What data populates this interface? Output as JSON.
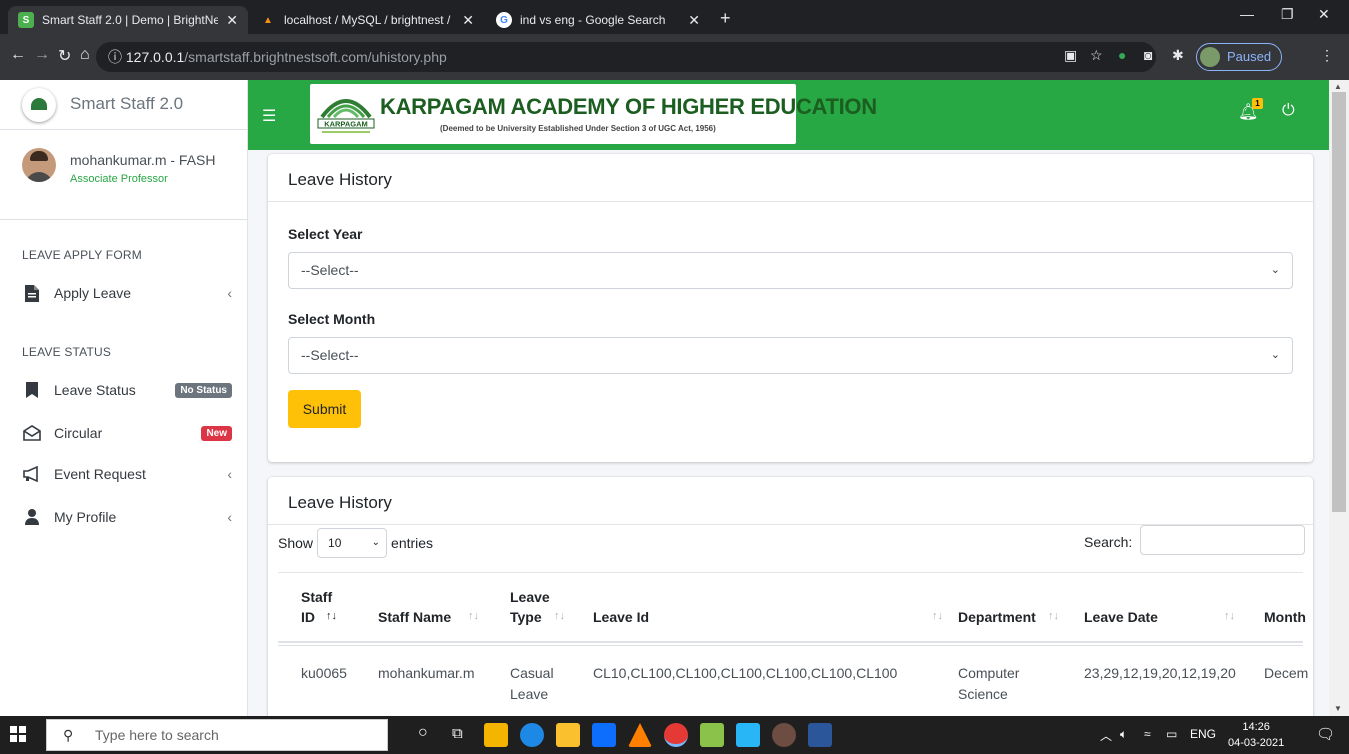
{
  "browser": {
    "tabs": [
      {
        "title": "Smart Staff 2.0 | Demo | BrightNe",
        "fav": "S",
        "fav_color": "#4caf50"
      },
      {
        "title": "localhost / MySQL / brightnest /",
        "fav": "▲",
        "fav_color": "#f29111"
      },
      {
        "title": "ind vs eng - Google Search",
        "fav": "G",
        "fav_color": "#ffffff"
      }
    ],
    "url_host": "127.0.0.1",
    "url_path": "/smartstaff.brightnestsoft.com/uhistory.php",
    "profile_status": "Paused"
  },
  "sidebar": {
    "brand": "Smart Staff 2.0",
    "user_name": "mohankumar.m - FASH",
    "user_role": "Associate Professor",
    "sections": {
      "apply": "LEAVE APPLY FORM",
      "status": "LEAVE STATUS"
    },
    "items": {
      "apply_leave": "Apply Leave",
      "leave_status": "Leave Status",
      "leave_status_badge": "No Status",
      "circular": "Circular",
      "circular_badge": "New",
      "event_request": "Event Request",
      "my_profile": "My Profile"
    }
  },
  "header": {
    "institution": "KARPAGAM ACADEMY OF HIGHER EDUCATION",
    "subtitle": "(Deemed to be University Established Under Section 3 of UGC Act, 1956)",
    "logo_text": "KARPAGAM",
    "notification_count": "1"
  },
  "filter_card": {
    "title": "Leave History",
    "year_label": "Select Year",
    "year_value": "--Select--",
    "month_label": "Select Month",
    "month_value": "--Select--",
    "submit": "Submit"
  },
  "table_card": {
    "title": "Leave History",
    "show": "Show",
    "entries_value": "10",
    "entries": "entries",
    "search_label": "Search:",
    "columns": {
      "staff_id_1": "Staff",
      "staff_id_2": "ID",
      "staff_name": "Staff Name",
      "leave_type_1": "Leave",
      "leave_type_2": "Type",
      "leave_id": "Leave Id",
      "department": "Department",
      "leave_date": "Leave Date",
      "month": "Month"
    },
    "rows": [
      {
        "staff_id": "ku0065",
        "staff_name": "mohankumar.m",
        "leave_type_1": "Casual",
        "leave_type_2": "Leave",
        "leave_id": "CL10,CL100,CL100,CL100,CL100,CL100,CL100",
        "department_1": "Computer",
        "department_2": "Science",
        "leave_date": "23,29,12,19,20,12,19,20",
        "month": "Decem"
      }
    ]
  },
  "taskbar": {
    "search_placeholder": "Type here to search",
    "language": "ENG",
    "time": "14:26",
    "date": "04-03-2021"
  },
  "colors": {
    "header_green": "#28a745",
    "submit_yellow": "#ffc107",
    "badge_gray": "#6c757d",
    "badge_red": "#dc3545"
  }
}
